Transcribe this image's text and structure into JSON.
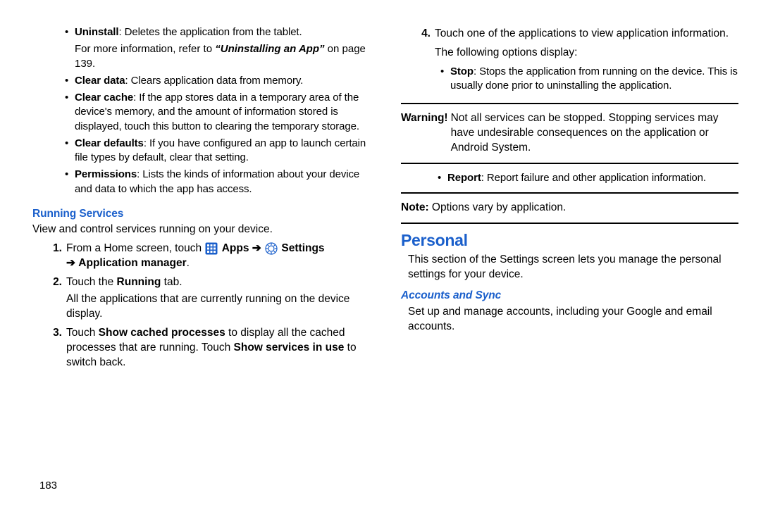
{
  "left": {
    "bullets": {
      "uninstall_label": "Uninstall",
      "uninstall_text": ": Deletes the application from the tablet.",
      "uninstall_more_a": "For more information, refer to ",
      "uninstall_more_b": "“Uninstalling an App”",
      "uninstall_more_c": "  on page 139.",
      "cleardata_label": "Clear data",
      "cleardata_text": ": Clears application data from memory.",
      "clearcache_label": "Clear cache",
      "clearcache_text": ": If the app stores data in a temporary area of the device's memory, and the amount of information stored is displayed, touch this button to clearing the temporary storage.",
      "cleardefaults_label": "Clear defaults",
      "cleardefaults_text": ": If you have configured an app to launch certain file types by default, clear that setting.",
      "permissions_label": "Permissions",
      "permissions_text": ": Lists the kinds of information about your device and data to which the app has access."
    },
    "running_heading": "Running Services",
    "running_intro": "View and control services running on your device.",
    "steps": {
      "s1n": "1.",
      "s1a": "From a Home screen, touch ",
      "s1_apps": " Apps",
      "s1_arrow1": " ➔ ",
      "s1_settings": " Settings",
      "s1_arrow2": "➔ ",
      "s1_appmgr": "Application manager",
      "s1_period": ".",
      "s2n": "2.",
      "s2a": "Touch the ",
      "s2b": "Running",
      "s2c": " tab.",
      "s2_sub": "All the applications that are currently running on the device display.",
      "s3n": "3.",
      "s3a": "Touch ",
      "s3b": "Show cached processes",
      "s3c": " to display all the cached processes that are running. Touch ",
      "s3d": "Show services in use",
      "s3e": " to switch back."
    }
  },
  "right": {
    "steps": {
      "s4n": "4.",
      "s4a": "Touch one of the applications to view application information.",
      "s4_sub": "The following options display:",
      "stop_label": "Stop",
      "stop_text": ": Stops the application from running on the device. This is usually done prior to uninstalling the application."
    },
    "warning_label": "Warning!",
    "warning_text": " Not all services can be stopped. Stopping services may have undesirable consequences on the application or Android System.",
    "report_label": "Report",
    "report_text": ": Report failure and other application information.",
    "note_label": "Note:",
    "note_text": " Options vary by application.",
    "personal_heading": "Personal",
    "personal_intro": "This section of the Settings screen lets you manage the personal settings for your device.",
    "accounts_heading": "Accounts and Sync",
    "accounts_text": "Set up and manage accounts, including your Google and email accounts."
  },
  "page_number": "183"
}
